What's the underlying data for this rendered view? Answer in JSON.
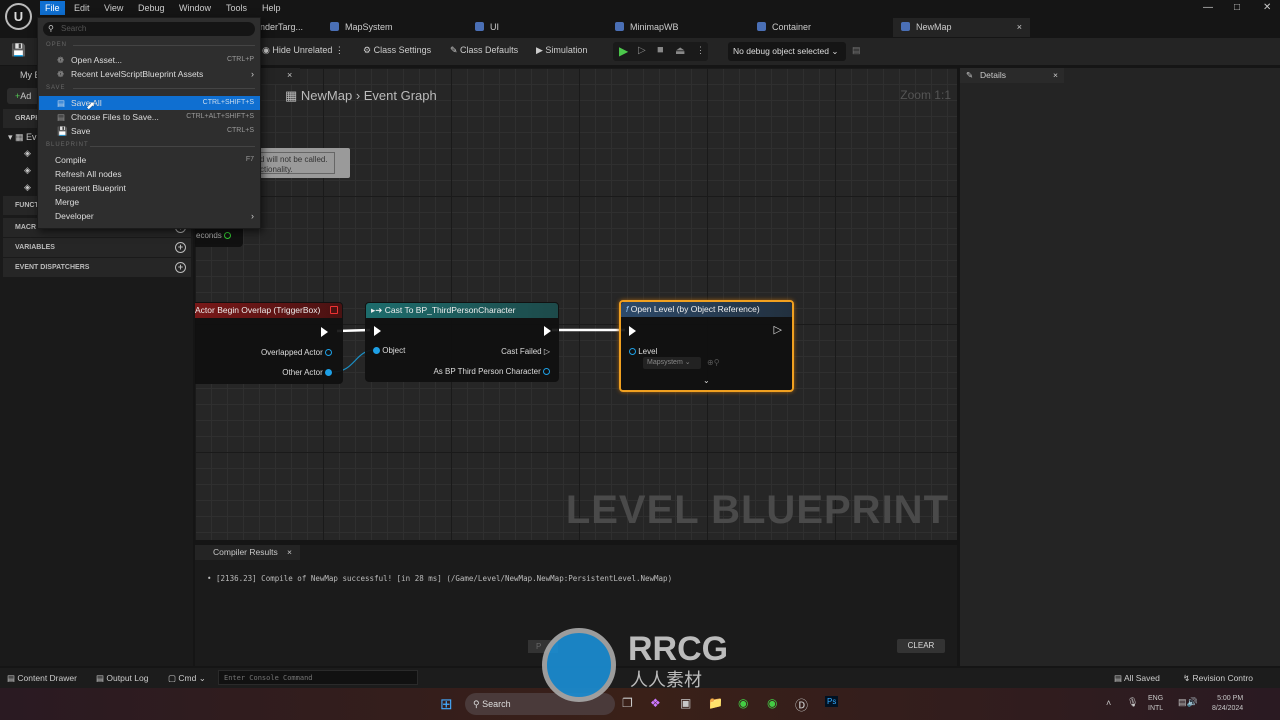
{
  "menubar": {
    "items": [
      "File",
      "Edit",
      "View",
      "Debug",
      "Window",
      "Tools",
      "Help"
    ]
  },
  "tabs": [
    {
      "label": "enderTarg..."
    },
    {
      "label": "MapSystem"
    },
    {
      "label": "UI"
    },
    {
      "label": "MinimapWB"
    },
    {
      "label": "Container"
    },
    {
      "label": "NewMap",
      "active": true
    }
  ],
  "toolbar": {
    "hide_unrelated": "Hide Unrelated",
    "class_settings": "Class Settings",
    "class_defaults": "Class Defaults",
    "simulation": "Simulation",
    "debug_object": "No debug object selected"
  },
  "file_menu": {
    "search_placeholder": "Search",
    "sections": {
      "open": "OPEN",
      "save": "SAVE",
      "blueprint": "BLUEPRINT"
    },
    "open_asset": {
      "label": "Open Asset...",
      "shortcut": "CTRL+P"
    },
    "recent": {
      "label": "Recent LevelScriptBlueprint Assets"
    },
    "save_all": {
      "label": "Save All",
      "shortcut": "CTRL+SHIFT+S"
    },
    "choose_files": {
      "label": "Choose Files to Save...",
      "shortcut": "CTRL+ALT+SHIFT+S"
    },
    "save": {
      "label": "Save",
      "shortcut": "CTRL+S"
    },
    "compile": {
      "label": "Compile",
      "shortcut": "F7"
    },
    "refresh": {
      "label": "Refresh All nodes"
    },
    "reparent": {
      "label": "Reparent Blueprint"
    },
    "merge": {
      "label": "Merge"
    },
    "developer": {
      "label": "Developer"
    }
  },
  "left_panel": {
    "tab": "My B",
    "add": "Ad",
    "graphs": "GRAPH",
    "event_graph": "Ev",
    "functions": "FUNCT",
    "macros": "MACR",
    "variables": "VARIABLES",
    "event_dispatchers": "EVENT DISPATCHERS"
  },
  "graph": {
    "breadcrumb_root": "NewMap",
    "breadcrumb_leaf": "Event Graph",
    "zoom": "Zoom 1:1",
    "watermark": "LEVEL BLUEPRINT",
    "comment": {
      "line1": "d will not be called.",
      "line2": "ctionality."
    },
    "partial_node": {
      "pin": "econds"
    },
    "overlap_node": {
      "title": "Actor Begin Overlap (TriggerBox)",
      "overlapped_actor": "Overlapped Actor",
      "other_actor": "Other Actor"
    },
    "cast_node": {
      "title": "Cast To BP_ThirdPersonCharacter",
      "object": "Object",
      "cast_failed": "Cast Failed",
      "as_bp": "As BP Third Person Character"
    },
    "open_level_node": {
      "title": "Open Level (by Object Reference)",
      "level": "Level",
      "level_value": "Mapsystem"
    }
  },
  "details": {
    "title": "Details"
  },
  "compiler": {
    "title": "Compiler Results",
    "message": "[2136.23] Compile of NewMap successful! [in 28 ms] (/Game/Level/NewMap.NewMap:PersistentLevel.NewMap)",
    "page_btn": "P",
    "clear": "CLEAR"
  },
  "statusbar": {
    "content_drawer": "Content Drawer",
    "output_log": "Output Log",
    "cmd": "Cmd",
    "console_placeholder": "Enter Console Command",
    "all_saved": "All Saved",
    "revision_control": "Revision Contro"
  },
  "taskbar": {
    "search": "Search",
    "lang1": "ENG",
    "lang2": "INTL",
    "time": "5:00 PM",
    "date": "8/24/2024"
  },
  "watermark_logo": {
    "text": "RRCG",
    "sub": "人人素材"
  },
  "colors": {
    "accent": "#0f6fd1",
    "event_header": "#8a1c1c",
    "cast_header": "#1d6c6c",
    "function_header": "#2d4a6a",
    "selected_border": "#f0a020",
    "object_pin": "#1ea0e6"
  }
}
